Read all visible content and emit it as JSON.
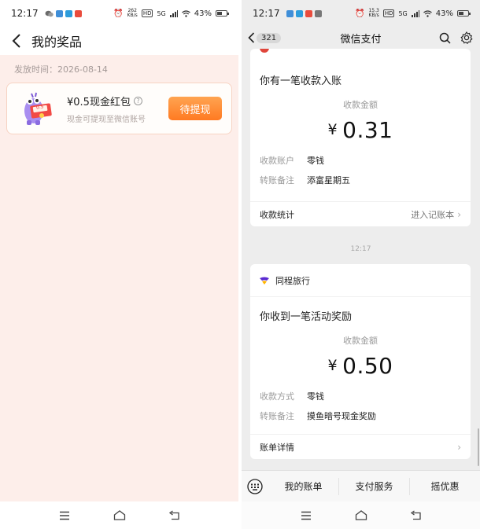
{
  "left": {
    "status": {
      "time": "12:17",
      "net_speed_top": "262",
      "net_speed_bottom": "KB/s",
      "hd": "HD",
      "signal": "5G",
      "battery": "43%",
      "battery_level": 0.43
    },
    "header": {
      "title": "我的奖品"
    },
    "issue_date": "发放时间：2026-08-14",
    "prize": {
      "name": "¥0.5现金红包",
      "desc": "现金可提现至微信账号",
      "art_label": "0.5",
      "button": "待提现"
    }
  },
  "right": {
    "status": {
      "time": "12:17",
      "net_speed_top": "15.3",
      "net_speed_bottom": "KB/s",
      "hd": "HD",
      "signal": "5G",
      "battery": "43%",
      "battery_level": 0.43
    },
    "header": {
      "back_badge": "321",
      "title": "微信支付"
    },
    "card1": {
      "heading": "你有一笔收款入账",
      "amount_label": "收款金额",
      "currency": "¥",
      "amount": "0.31",
      "fields": [
        {
          "k": "收款账户",
          "v": "零钱"
        },
        {
          "k": "转账备注",
          "v": "添富星期五"
        }
      ],
      "link_left": "收款统计",
      "link_right": "进入记账本"
    },
    "timestamp": "12:17",
    "card2": {
      "sender": "同程旅行",
      "heading": "你收到一笔活动奖励",
      "amount_label": "收款金额",
      "currency": "¥",
      "amount": "0.50",
      "fields": [
        {
          "k": "收款方式",
          "v": "零钱"
        },
        {
          "k": "转账备注",
          "v": "摸鱼暗号现金奖励"
        }
      ],
      "link_left": "账单详情"
    },
    "menu": [
      "我的账单",
      "支付服务",
      "摇优惠"
    ]
  },
  "colors": {
    "accent_orange": "#ff8a2e",
    "left_bg": "#fdeeea",
    "wechat_bg": "#ededed",
    "sender_logo": "#5b2bd1"
  },
  "icons": [
    "back-chevron-icon",
    "info-icon",
    "search-icon",
    "gear-icon",
    "keyboard-icon",
    "menu-lines-icon",
    "home-icon",
    "back-arrow-icon"
  ]
}
